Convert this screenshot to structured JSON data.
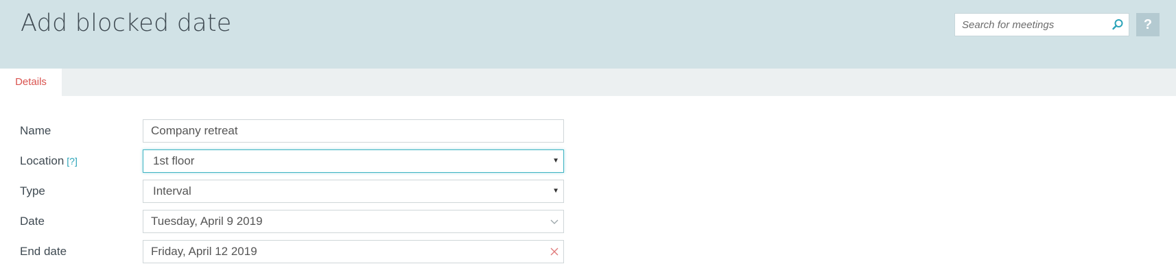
{
  "header": {
    "title": "Add blocked date",
    "search_placeholder": "Search for meetings",
    "search_icon": "search-icon",
    "help_label": "?"
  },
  "tabs": [
    {
      "label": "Details",
      "active": true,
      "color": "#d9534f"
    }
  ],
  "form": {
    "name": {
      "label": "Name",
      "value": "Company retreat"
    },
    "location": {
      "label": "Location",
      "help": "[?]",
      "value": "1st floor"
    },
    "type": {
      "label": "Type",
      "value": "Interval"
    },
    "date": {
      "label": "Date",
      "value": "Tuesday, April 9 2019"
    },
    "end_date": {
      "label": "End date",
      "value": "Friday, April 12 2019"
    }
  },
  "colors": {
    "header_bg": "#d1e2e6",
    "tab_bar_bg": "#ecf0f1",
    "accent": "#2aa3b8",
    "active_tab": "#d9534f"
  }
}
